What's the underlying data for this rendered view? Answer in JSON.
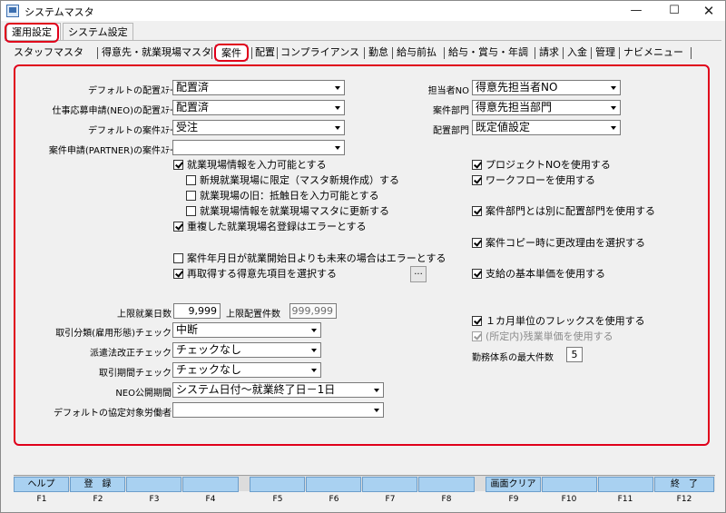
{
  "window": {
    "title": "システムマスタ",
    "min_glyph": "—",
    "max_glyph": "☐",
    "close_glyph": "✕"
  },
  "outer_tabs": [
    "運用設定",
    "システム設定"
  ],
  "inner_tabs": [
    "スタッフマスタ",
    "得意先・就業現場マスタ",
    "案件",
    "配置",
    "コンプライアンス",
    "勤怠",
    "給与前払",
    "給与・賞与・年調",
    "請求",
    "入金",
    "管理",
    "ナビメニュー"
  ],
  "left_fields": [
    {
      "label": "デフォルトの配置ｽﾃｰﾀｽ",
      "value": "配置済"
    },
    {
      "label": "仕事応募申請(NEO)の配置ｽﾃｰﾀｽ",
      "value": "配置済"
    },
    {
      "label": "デフォルトの案件ｽﾃｰﾀｽ",
      "value": "受注"
    },
    {
      "label": "案件申請(PARTNER)の案件ｽﾃｰﾀｽ",
      "value": ""
    }
  ],
  "right_fields": [
    {
      "label": "担当者NO",
      "value": "得意先担当者NO"
    },
    {
      "label": "案件部門",
      "value": "得意先担当部門"
    },
    {
      "label": "配置部門",
      "value": "既定値設定"
    }
  ],
  "left_checks": [
    {
      "label": "就業現場情報を入力可能とする",
      "checked": true
    },
    {
      "label": "新規就業現場に限定（マスタ新規作成）する",
      "checked": false
    },
    {
      "label": "就業現場の旧：抵触日を入力可能とする",
      "checked": false
    },
    {
      "label": "就業現場情報を就業現場マスタに更新する",
      "checked": false
    },
    {
      "label": "重複した就業現場名登録はエラーとする",
      "checked": true
    },
    {
      "label": "案件年月日が就業開始日よりも未来の場合はエラーとする",
      "checked": false
    },
    {
      "label": "再取得する得意先項目を選択する",
      "checked": true
    }
  ],
  "dots_label": "...",
  "right_checks": [
    {
      "label": "プロジェクトNOを使用する",
      "checked": true
    },
    {
      "label": "ワークフローを使用する",
      "checked": true
    },
    {
      "label": "案件部門とは別に配置部門を使用する",
      "checked": true
    },
    {
      "label": "案件コピー時に更改理由を選択する",
      "checked": true
    },
    {
      "label": "支給の基本単価を使用する",
      "checked": true
    },
    {
      "label": "１カ月単位のフレックスを使用する",
      "checked": true
    },
    {
      "label": "(所定内)残業単価を使用する",
      "checked": true
    }
  ],
  "limits": {
    "max_days_label": "上限就業日数",
    "max_days": "9,999",
    "max_place_label": "上限配置件数",
    "max_place": "999,999"
  },
  "bottom_fields": [
    {
      "label": "取引分類(雇用形態)チェック",
      "value": "中断"
    },
    {
      "label": "派遣法改正チェック",
      "value": "チェックなし"
    },
    {
      "label": "取引期間チェック",
      "value": "チェックなし"
    },
    {
      "label": "NEO公開期間",
      "value": "システム日付〜就業終了日－1日"
    },
    {
      "label": "デフォルトの協定対象労働者",
      "value": ""
    }
  ],
  "max_work": {
    "label": "勤務体系の最大件数",
    "value": "5"
  },
  "fbuttons": [
    {
      "key": "F1",
      "label": "ヘルプ"
    },
    {
      "key": "F2",
      "label": "登　録"
    },
    {
      "key": "F3",
      "label": ""
    },
    {
      "key": "F4",
      "label": ""
    },
    {
      "key": "F5",
      "label": ""
    },
    {
      "key": "F6",
      "label": ""
    },
    {
      "key": "F7",
      "label": ""
    },
    {
      "key": "F8",
      "label": ""
    },
    {
      "key": "F9",
      "label": "画面クリア"
    },
    {
      "key": "F10",
      "label": ""
    },
    {
      "key": "F11",
      "label": ""
    },
    {
      "key": "F12",
      "label": "終　了"
    }
  ],
  "colors": {
    "highlight": "#e0001b",
    "fkey_button": "#a9d1f1"
  }
}
